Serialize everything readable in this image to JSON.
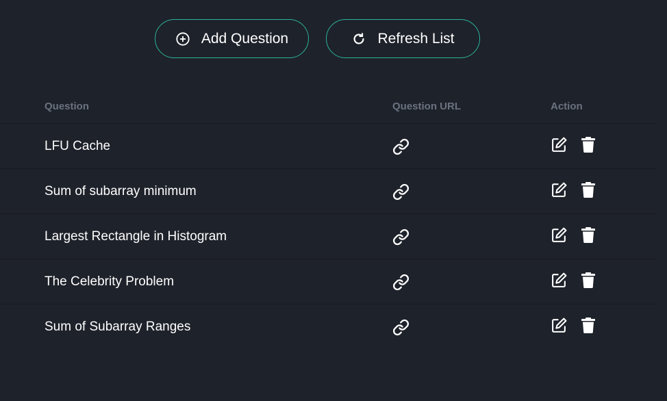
{
  "toolbar": {
    "add_label": "Add Question",
    "add_icon": "plus-circle-icon",
    "refresh_label": "Refresh List",
    "refresh_icon": "refresh-icon",
    "accent": "#2bb39a"
  },
  "table": {
    "headers": [
      "Question",
      "Question URL",
      "Action"
    ],
    "rows": [
      {
        "question": "LFU Cache"
      },
      {
        "question": "Sum of subarray minimum"
      },
      {
        "question": "Largest Rectangle in Histogram"
      },
      {
        "question": "The Celebrity Problem"
      },
      {
        "question": "Sum of Subarray Ranges"
      }
    ]
  },
  "icons": {
    "url": "link-icon",
    "edit": "edit-icon",
    "delete": "trash-icon"
  }
}
